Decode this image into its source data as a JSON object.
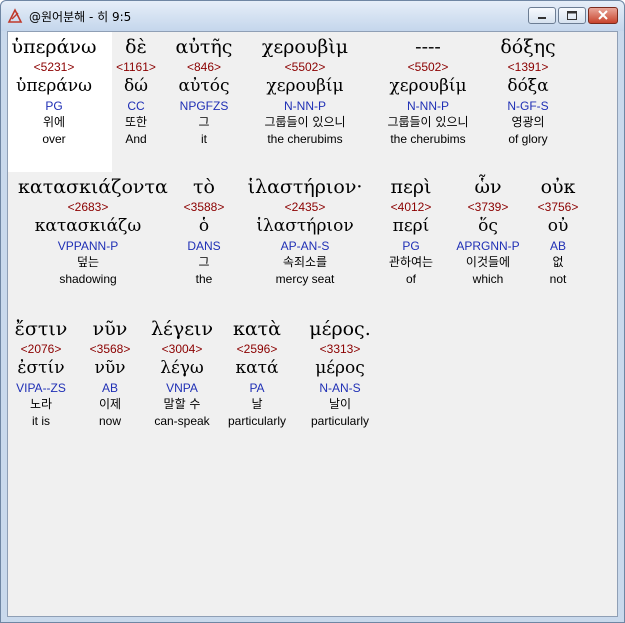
{
  "window": {
    "title": "@원어분해 - 히 9:5"
  },
  "lines": [
    [
      {
        "greek": "ὑπεράνω",
        "strong": "<5231>",
        "lemma": "ὑπεράνω",
        "parse": "PG",
        "korean": "위에",
        "english": "over"
      },
      {
        "greek": "δὲ",
        "strong": "<1161>",
        "lemma": "δώ",
        "parse": "CC",
        "korean": "또한",
        "english": "And"
      },
      {
        "greek": "αὐτῆς",
        "strong": "<846>",
        "lemma": "αὐτός",
        "parse": "NPGFZS",
        "korean": "그",
        "english": "it"
      },
      {
        "greek": "χερουβὶμ",
        "strong": "<5502>",
        "lemma": "χερουβίμ",
        "parse": "N-NN-P",
        "korean": "그룹들이 있으니",
        "english": "the cherubims"
      },
      {
        "greek": "----",
        "strong": "<5502>",
        "lemma": "χερουβίμ",
        "parse": "N-NN-P",
        "korean": "그룹들이 있으니",
        "english": "the cherubims"
      },
      {
        "greek": "δόξης",
        "strong": "<1391>",
        "lemma": "δόξα",
        "parse": "N-GF-S",
        "korean": "영광의",
        "english": "of glory"
      }
    ],
    [
      {
        "greek": "κατασκιάζοντα",
        "strong": "<2683>",
        "lemma": "κατασκιάζω",
        "parse": "VPPANN-P",
        "korean": "덮는",
        "english": "shadowing"
      },
      {
        "greek": "τὸ",
        "strong": "<3588>",
        "lemma": "ὁ",
        "parse": "DANS",
        "korean": "그",
        "english": "the"
      },
      {
        "greek": "ἱλαστήριον·",
        "strong": "<2435>",
        "lemma": "ἱλαστήριον",
        "parse": "AP-AN-S",
        "korean": "속죄소를",
        "english": "mercy seat"
      },
      {
        "greek": "περὶ",
        "strong": "<4012>",
        "lemma": "περί",
        "parse": "PG",
        "korean": "관하여는",
        "english": "of"
      },
      {
        "greek": "ὧν",
        "strong": "<3739>",
        "lemma": "ὅς",
        "parse": "APRGNN-P",
        "korean": "이것들에",
        "english": "which"
      },
      {
        "greek": "οὐκ",
        "strong": "<3756>",
        "lemma": "οὐ",
        "parse": "AB",
        "korean": "없",
        "english": "not"
      }
    ],
    [
      {
        "greek": "ἔστιν",
        "strong": "<2076>",
        "lemma": "ἐστίν",
        "parse": "VIPA--ZS",
        "korean": "노라",
        "english": "it is"
      },
      {
        "greek": "νῦν",
        "strong": "<3568>",
        "lemma": "νῦν",
        "parse": "AB",
        "korean": "이제",
        "english": "now"
      },
      {
        "greek": "λέγειν",
        "strong": "<3004>",
        "lemma": "λέγω",
        "parse": "VNPA",
        "korean": "말할 수",
        "english": "can-speak"
      },
      {
        "greek": "κατὰ",
        "strong": "<2596>",
        "lemma": "κατά",
        "parse": "PA",
        "korean": "날",
        "english": "particularly"
      },
      {
        "greek": "μέρος.",
        "strong": "<3313>",
        "lemma": "μέρος",
        "parse": "N-AN-S",
        "korean": "날이",
        "english": "particularly"
      }
    ]
  ]
}
